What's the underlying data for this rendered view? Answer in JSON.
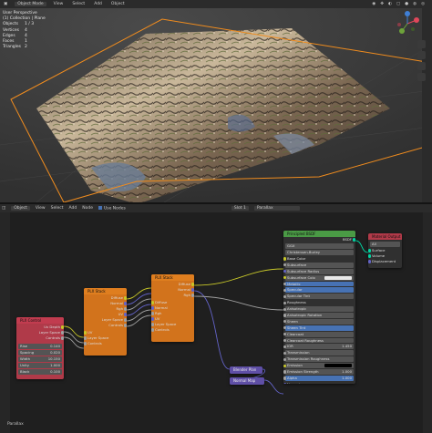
{
  "viewport": {
    "header": {
      "mode": "Object Mode",
      "menus": [
        "View",
        "Select",
        "Add",
        "Object"
      ]
    },
    "info": {
      "view_name": "User Perspective",
      "collection": "(1) Collection | Plane",
      "stats": [
        {
          "label": "Objects",
          "value": "1 / 3"
        },
        {
          "label": "Vertices",
          "value": "4"
        },
        {
          "label": "Edges",
          "value": "4"
        },
        {
          "label": "Faces",
          "value": "1"
        },
        {
          "label": "Triangles",
          "value": "2"
        }
      ]
    }
  },
  "node_editor": {
    "header": {
      "type": "Object",
      "menus": [
        "View",
        "Select",
        "Add",
        "Node"
      ],
      "use_nodes": "Use Nodes",
      "slot": "Slot 1",
      "material": "Parallax"
    },
    "nodes": {
      "plx_control": {
        "title": "PLX Control",
        "outputs": [
          "Uv Depth",
          "Layer Space",
          "Controls"
        ],
        "fields": [
          {
            "label": "Rise",
            "value": "0.140"
          },
          {
            "label": "Spacing",
            "value": "0.020"
          },
          {
            "label": "Width",
            "value": "10.150"
          },
          {
            "label": "Unity",
            "value": "1.000"
          },
          {
            "label": "Black",
            "value": "0.100"
          }
        ]
      },
      "plx_stack_1": {
        "title": "PLX Stack",
        "outputs": [
          "Diffuse",
          "Normal",
          "Rgh",
          "UV",
          "Layer Space",
          "Controls"
        ],
        "inputs": [
          "UV",
          "Layer Space",
          "Controls"
        ]
      },
      "plx_stack_2": {
        "title": "PLX Stack",
        "outputs": [
          "Diffuse",
          "Normal",
          "Rgh"
        ],
        "inputs": [
          "Diffuse",
          "Normal",
          "Rgh",
          "UV",
          "Layer Space",
          "Controls"
        ]
      },
      "principled": {
        "title": "Principled BSDF",
        "output": "BSDF",
        "distribution": "GGX",
        "subsurface_method": "Christensen-Burley",
        "rows": [
          "Base Color",
          "Subsurface",
          "Subsurface Radius",
          "Subsurface Colo",
          "Metallic",
          "Specular",
          "Specular Tint",
          "Roughness",
          "Anisotropic",
          "Anisotropic Rotation",
          "Sheen",
          "Sheen Tint",
          "Clearcoat",
          "Clearcoat Roughness",
          "IOR",
          "Transmission",
          "Transmission Roughness",
          "Emission",
          "Emission Strength",
          "Alpha",
          "Normal",
          "Clearcoat Normal",
          "Tangent"
        ],
        "values": {
          "ior": "1.450",
          "emission_strength": "1.000",
          "alpha": "1.000"
        }
      },
      "material_output": {
        "title": "Material Output",
        "target": "All",
        "inputs": [
          "Surface",
          "Volume",
          "Displacement"
        ]
      },
      "normal_mix": {
        "title": "Blender Plan"
      },
      "normal_map": {
        "title": "Normal Map"
      }
    },
    "footer": "Parallax"
  },
  "colors": {
    "group_node": "#df7e1f",
    "control_node": "#c13c4f",
    "shader_header": "#4a9a45",
    "output_header": "#b23a49",
    "vector_node": "#5f4fa6",
    "selected_field": "#4772b3"
  }
}
